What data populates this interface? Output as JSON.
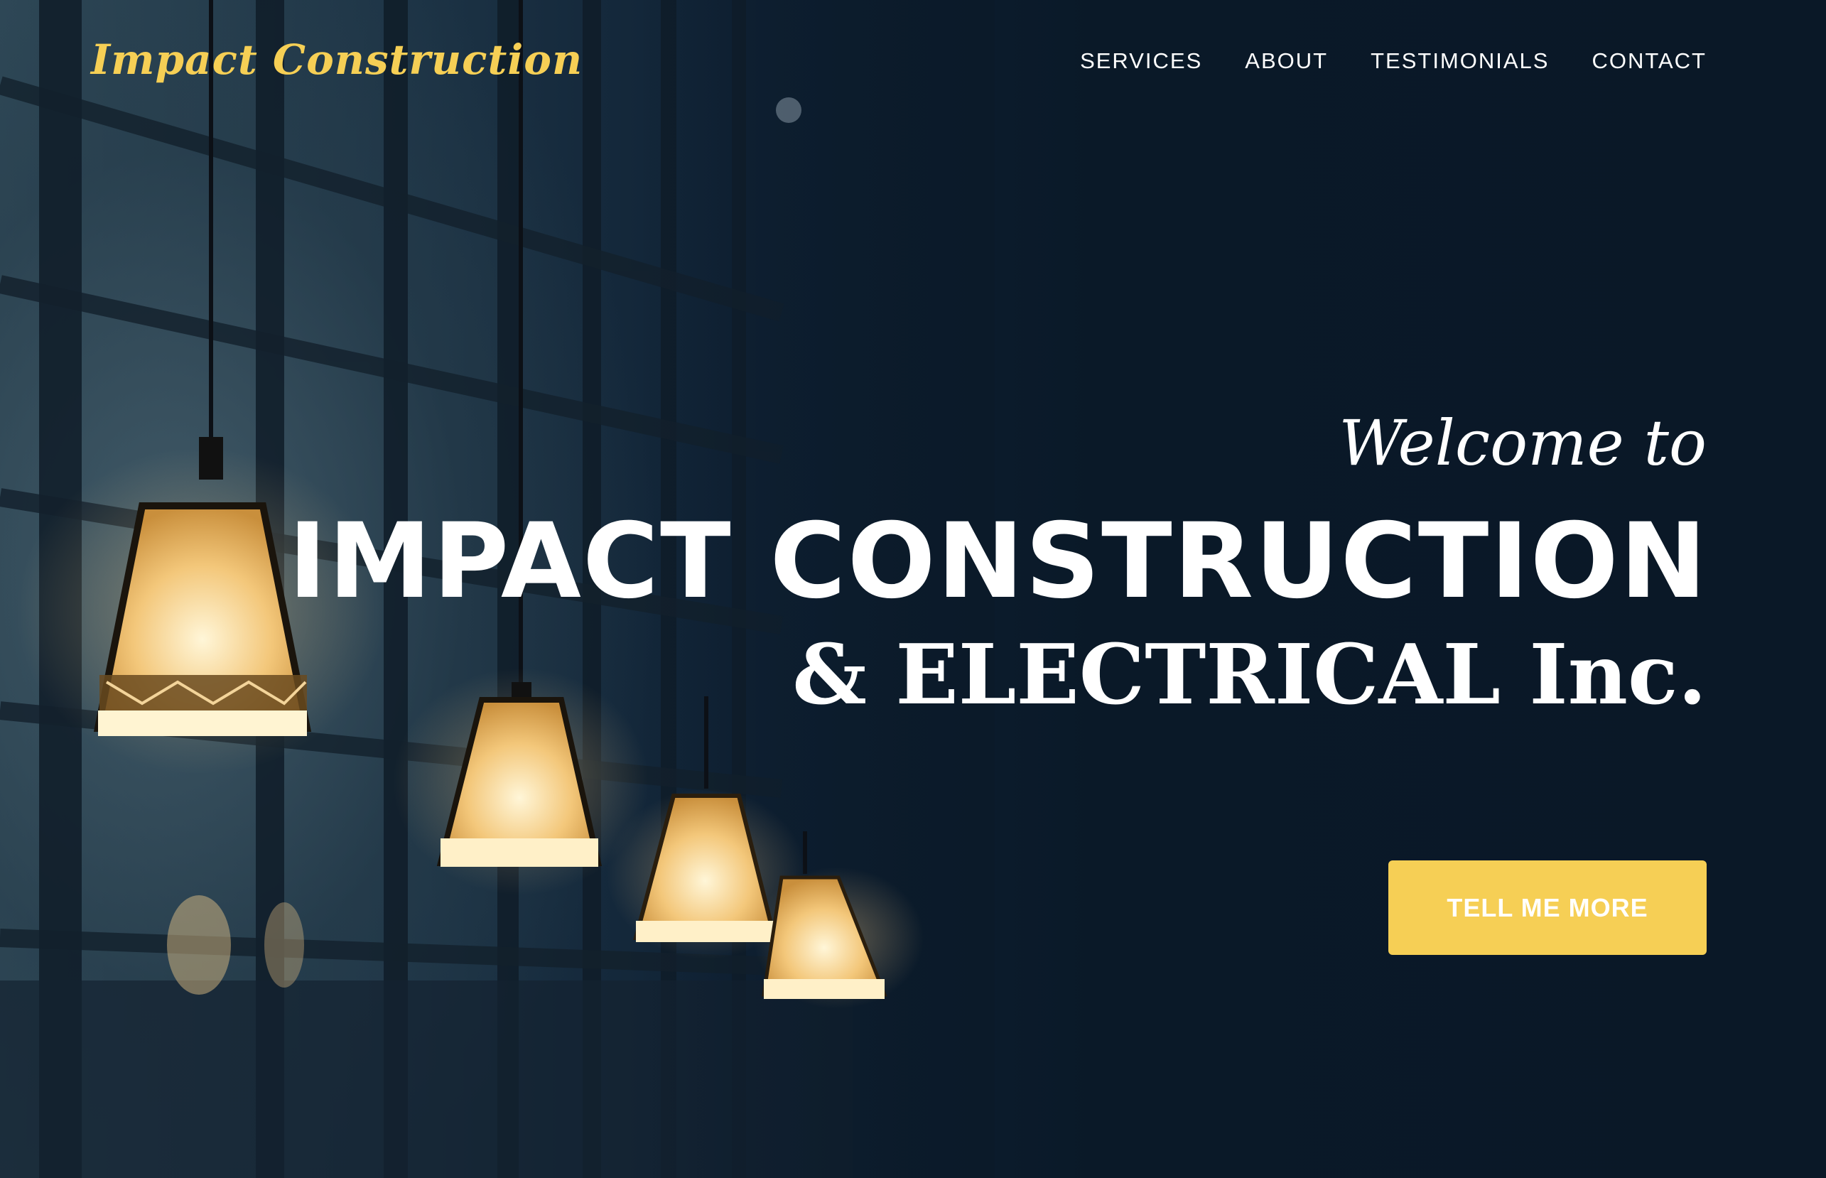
{
  "header": {
    "brand": "Impact Construction",
    "nav": [
      {
        "label": "SERVICES"
      },
      {
        "label": "ABOUT"
      },
      {
        "label": "TESTIMONIALS"
      },
      {
        "label": "CONTACT"
      }
    ]
  },
  "hero": {
    "welcome": "Welcome to",
    "headline": "IMPACT CONSTRUCTION",
    "subhead": "& ELECTRICAL Inc.",
    "cta_label": "TELL ME MORE"
  },
  "colors": {
    "accent": "#f6cf55",
    "background": "#0b1a29",
    "text": "#ffffff"
  }
}
